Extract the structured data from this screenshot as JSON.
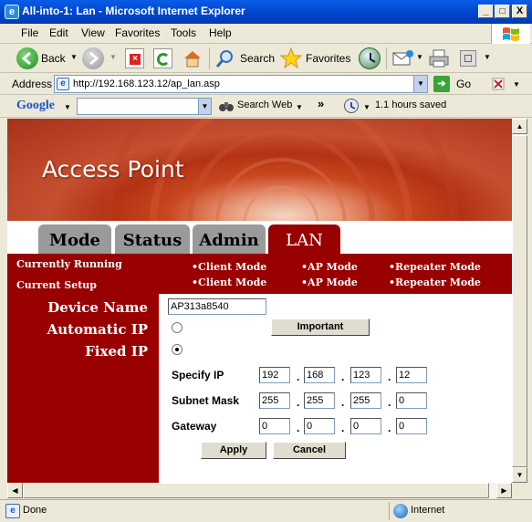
{
  "window": {
    "title": "All-into-1: Lan - Microsoft Internet Explorer",
    "minimize": "_",
    "maximize": "□",
    "close": "X"
  },
  "menu": [
    "File",
    "Edit",
    "View",
    "Favorites",
    "Tools",
    "Help"
  ],
  "toolbar": {
    "back": "Back",
    "search": "Search",
    "favorites": "Favorites"
  },
  "address": {
    "label": "Address",
    "url": "http://192.168.123.12/ap_lan.asp",
    "go": "Go"
  },
  "googlebar": {
    "brand": "Google",
    "search_web": "Search Web",
    "chevron": "»",
    "status": "1.1 hours saved"
  },
  "banner": {
    "title": "Access Point"
  },
  "tabs": [
    "Mode",
    "Status",
    "Admin",
    "LAN"
  ],
  "mode_strip": {
    "currently_running": "Currently Running",
    "current_setup": "Current Setup",
    "running": [
      "•Client Mode",
      "•AP Mode",
      "•Repeater Mode"
    ],
    "setup": [
      "•Client Mode",
      "•AP Mode",
      "•Repeater Mode"
    ]
  },
  "form": {
    "device_name_label": "Device Name",
    "device_name_value": "AP313a8540",
    "automatic_ip_label": "Automatic IP",
    "fixed_ip_label": "Fixed IP",
    "important_button": "Important",
    "specify_ip_label": "Specify IP",
    "specify_ip": [
      "192",
      "168",
      "123",
      "12"
    ],
    "subnet_mask_label": "Subnet Mask",
    "subnet_mask": [
      "255",
      "255",
      "255",
      "0"
    ],
    "gateway_label": "Gateway",
    "gateway": [
      "0",
      "0",
      "0",
      "0"
    ],
    "dot": ".",
    "apply": "Apply",
    "cancel": "Cancel",
    "selected_ip_mode": "Fixed IP"
  },
  "status": {
    "text": "Done",
    "zone": "Internet"
  },
  "colors": {
    "accent": "#990000",
    "titlebar": "#0a5ce6",
    "tab_inactive": "#9a9a9a"
  }
}
